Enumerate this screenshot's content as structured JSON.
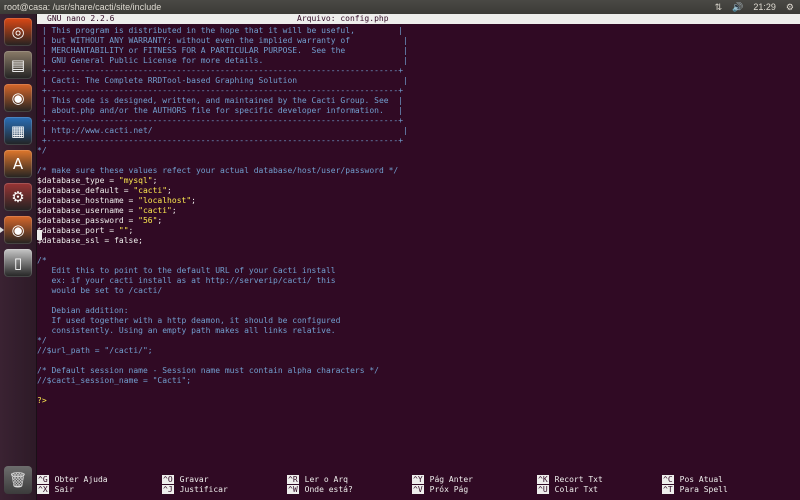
{
  "window": {
    "title": "root@casa: /usr/share/cacti/site/include"
  },
  "tray": {
    "keyboard": "⇅",
    "volume": "🔊",
    "time": "21:29",
    "power": "⚙"
  },
  "launcher": {
    "items": [
      {
        "name": "dash-home-icon",
        "glyph": "◎",
        "color": "#dd4814"
      },
      {
        "name": "files-icon",
        "glyph": "▤",
        "color": "#8a7b68"
      },
      {
        "name": "firefox-icon",
        "glyph": "◉",
        "color": "#d8672a"
      },
      {
        "name": "writer-icon",
        "glyph": "▦",
        "color": "#2a6fb8"
      },
      {
        "name": "software-center-icon",
        "glyph": "A",
        "color": "#e0772c"
      },
      {
        "name": "settings-icon",
        "glyph": "⚙",
        "color": "#9a3535"
      },
      {
        "name": "firefox-icon",
        "glyph": "◉",
        "color": "#d8672a"
      },
      {
        "name": "usb-drive-icon",
        "glyph": "▯",
        "color": "#c7c7c7"
      }
    ],
    "trash": "🗑"
  },
  "nano": {
    "version": "GNU nano 2.2.6",
    "filename": "Arquivo: config.php"
  },
  "editor": {
    "lines": [
      {
        "t": " | This program is distributed in the hope that it will be useful,         |",
        "k": "c"
      },
      {
        "t": " | but WITHOUT ANY WARRANTY; without even the implied warranty of           |",
        "k": "c"
      },
      {
        "t": " | MERCHANTABILITY or FITNESS FOR A PARTICULAR PURPOSE.  See the            |",
        "k": "c"
      },
      {
        "t": " | GNU General Public License for more details.                             |",
        "k": "c"
      },
      {
        "t": " +-------------------------------------------------------------------------+",
        "k": "c"
      },
      {
        "t": " | Cacti: The Complete RRDTool-based Graphing Solution                      |",
        "k": "c"
      },
      {
        "t": " +-------------------------------------------------------------------------+",
        "k": "c"
      },
      {
        "t": " | This code is designed, written, and maintained by the Cacti Group. See  |",
        "k": "c"
      },
      {
        "t": " | about.php and/or the AUTHORS file for specific developer information.   |",
        "k": "c"
      },
      {
        "t": " +-------------------------------------------------------------------------+",
        "k": "c"
      },
      {
        "t": " | http://www.cacti.net/                                                    |",
        "k": "c"
      },
      {
        "t": " +-------------------------------------------------------------------------+",
        "k": "c"
      },
      {
        "t": "*/",
        "k": "c"
      },
      {
        "t": "",
        "k": "d"
      },
      {
        "t": "/* make sure these values refect your actual database/host/user/password */",
        "k": "c"
      },
      {
        "pre": "$database_type = ",
        "str": "\"mysql\"",
        "post": ";",
        "k": "kv"
      },
      {
        "pre": "$database_default = ",
        "str": "\"cacti\"",
        "post": ";",
        "k": "kv"
      },
      {
        "pre": "$database_hostname = ",
        "str": "\"localhost\"",
        "post": ";",
        "k": "kv"
      },
      {
        "pre": "$database_username = ",
        "str": "\"cacti\"",
        "post": ";",
        "k": "kv"
      },
      {
        "pre": "$database_password = ",
        "str": "\"56\"",
        "post": ";",
        "k": "kv"
      },
      {
        "pre": "$database_port = ",
        "str": "\"\"",
        "post": ";",
        "k": "kv"
      },
      {
        "t": "$database_ssl = false;",
        "k": "d"
      },
      {
        "t": "",
        "k": "d"
      },
      {
        "t": "/*",
        "k": "c"
      },
      {
        "t": "   Edit this to point to the default URL of your Cacti install",
        "k": "c"
      },
      {
        "t": "   ex: if your cacti install as at http://serverip/cacti/ this",
        "k": "c"
      },
      {
        "t": "   would be set to /cacti/",
        "k": "c"
      },
      {
        "t": "",
        "k": "d"
      },
      {
        "t": "   Debian addition:",
        "k": "c"
      },
      {
        "t": "   If used together with a http deamon, it should be configured",
        "k": "c"
      },
      {
        "t": "   consistently. Using an empty path makes all links relative.",
        "k": "c"
      },
      {
        "t": "*/",
        "k": "c"
      },
      {
        "t": "//$url_path = \"/cacti/\";",
        "k": "c"
      },
      {
        "t": "",
        "k": "d"
      },
      {
        "t": "/* Default session name - Session name must contain alpha characters */",
        "k": "c"
      },
      {
        "t": "//$cacti_session_name = \"Cacti\";",
        "k": "c"
      },
      {
        "t": "",
        "k": "d"
      },
      {
        "t": "?>",
        "k": "p"
      }
    ]
  },
  "shortcuts": [
    {
      "key": "^G",
      "label": "Obter Ajuda",
      "col": 0,
      "row": 0
    },
    {
      "key": "^X",
      "label": "Sair",
      "col": 0,
      "row": 1
    },
    {
      "key": "^O",
      "label": "Gravar",
      "col": 1,
      "row": 0
    },
    {
      "key": "^J",
      "label": "Justificar",
      "col": 1,
      "row": 1
    },
    {
      "key": "^R",
      "label": "Ler o Arq",
      "col": 2,
      "row": 0
    },
    {
      "key": "^W",
      "label": "Onde está?",
      "col": 2,
      "row": 1
    },
    {
      "key": "^Y",
      "label": "Pág Anter",
      "col": 3,
      "row": 0
    },
    {
      "key": "^V",
      "label": "Próx Pág",
      "col": 3,
      "row": 1
    },
    {
      "key": "^K",
      "label": "Recort Txt",
      "col": 4,
      "row": 0
    },
    {
      "key": "^U",
      "label": "Colar Txt",
      "col": 4,
      "row": 1
    },
    {
      "key": "^C",
      "label": "Pos Atual",
      "col": 5,
      "row": 0
    },
    {
      "key": "^T",
      "label": "Para Spell",
      "col": 5,
      "row": 1
    }
  ]
}
